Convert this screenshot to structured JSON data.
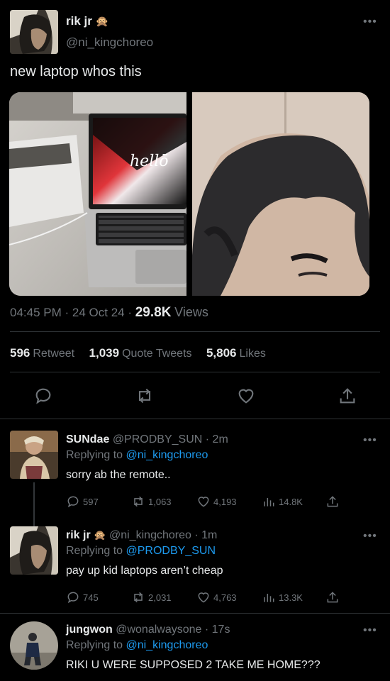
{
  "main_tweet": {
    "display_name": "rik jr",
    "name_emoji": "🙊",
    "handle": "@ni_kingchoreo",
    "text": "new laptop whos this",
    "laptop_screen_text": "hellō",
    "time": "04:45 PM",
    "date": "24 Oct 24",
    "views_count": "29.8K",
    "views_label": "Views",
    "retweets_count": "596",
    "retweets_label": "Retweet",
    "quotes_count": "1,039",
    "quotes_label": "Quote Tweets",
    "likes_count": "5,806",
    "likes_label": "Likes",
    "more": "•••",
    "icons": [
      "reply-icon",
      "retweet-icon",
      "like-icon",
      "share-icon"
    ]
  },
  "replies": [
    {
      "display_name": "SUNdae",
      "handle": "@PRODBY_SUN",
      "time": "2m",
      "replying_label": "Replying to",
      "replying_to": "@ni_kingchoreo",
      "text": "sorry ab the remote..",
      "reply_count": "597",
      "retweet_count": "1,063",
      "like_count": "4,193",
      "view_count": "14.8K"
    },
    {
      "display_name": "rik jr",
      "name_emoji": "🙊",
      "handle": "@ni_kingchoreo",
      "time": "1m",
      "replying_label": "Replying to",
      "replying_to": "@PRODBY_SUN",
      "text": "pay up kid laptops aren’t cheap",
      "reply_count": "745",
      "retweet_count": "2,031",
      "like_count": "4,763",
      "view_count": "13.3K"
    },
    {
      "display_name": "jungwon",
      "handle": "@wonalwaysone",
      "time": "17s",
      "replying_label": "Replying to",
      "replying_to": "@ni_kingchoreo",
      "text": "RIKI U WERE SUPPOSED 2 TAKE ME HOME???"
    }
  ],
  "colors": {
    "background": "#000000",
    "text": "#e7e9ea",
    "muted": "#71767b",
    "link": "#1d9bf0",
    "divider": "#2f3336"
  }
}
